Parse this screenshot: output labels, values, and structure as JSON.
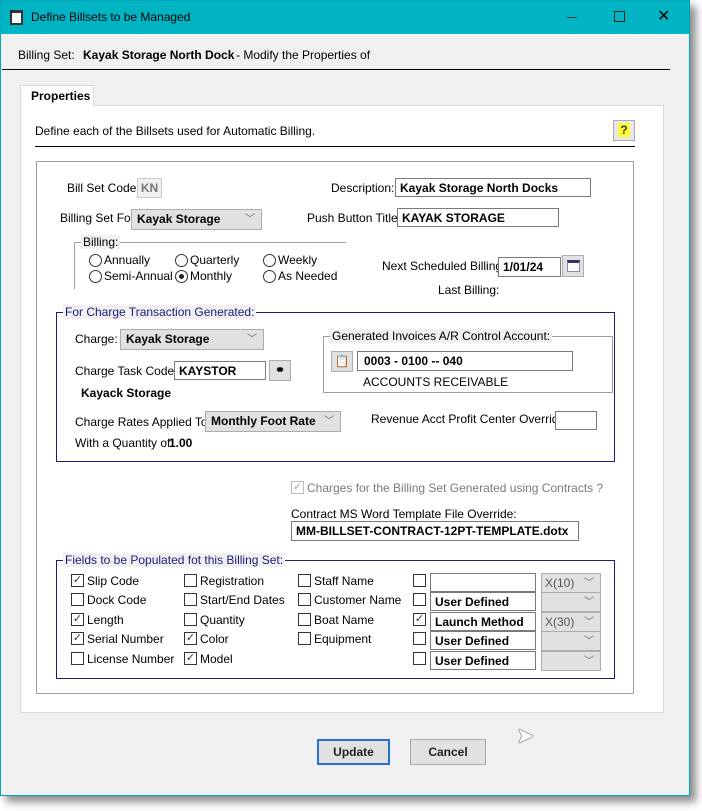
{
  "window": {
    "title": "Define Billsets to be Managed"
  },
  "header": {
    "billing_set_label": "Billing Set:",
    "billing_set_name": "Kayak Storage North Dock",
    "billing_set_suffix": "- Modify the Properties of"
  },
  "tab": {
    "label": "Properties"
  },
  "intro": "Define each of the Billsets used for Automatic Billing.",
  "form": {
    "bill_set_code_label": "Bill Set Code:",
    "bill_set_code": "KN",
    "description_label": "Description:",
    "description": "Kayak Storage North Docks",
    "billing_set_for_label": "Billing Set For:",
    "billing_set_for": "Kayak Storage",
    "push_button_title_label": "Push Button Title:",
    "push_button_title": "KAYAK STORAGE",
    "billing_label": "Billing:",
    "billing_options": [
      "Annually",
      "Quarterly",
      "Weekly",
      "Semi-Annual",
      "Monthly",
      "As Needed"
    ],
    "billing_selected": "Monthly",
    "next_billing_label": "Next Scheduled Billing:",
    "next_billing": "1/01/24",
    "last_billing_label": "Last Billing:"
  },
  "charge": {
    "group_label": "For Charge Transaction Generated:",
    "charge_label": "Charge:",
    "charge": "Kayak Storage",
    "task_code_label": "Charge Task Code:",
    "task_code": "KAYSTOR",
    "task_name": "Kayack Storage",
    "ar_group_label": "Generated Invoices A/R Control Account:",
    "ar_account": "0003 - 0100 -- 040",
    "ar_name": "ACCOUNTS RECEIVABLE",
    "rates_label": "Charge Rates Applied To:",
    "rates": "Monthly Foot Rate",
    "profit_center_label": "Revenue Acct Profit Center Override:",
    "profit_center": "",
    "quantity_label": "With a Quantity of:",
    "quantity": "1.00"
  },
  "contracts": {
    "checkbox_label": "Charges for the Billing Set Generated using Contracts ?",
    "checked": true,
    "template_label": "Contract MS Word Template File Override:",
    "template": "MM-BILLSET-CONTRACT-12PT-TEMPLATE.dotx"
  },
  "fields": {
    "group_label": "Fields to be Populated fot this Billing Set:",
    "columns": [
      [
        {
          "label": "Slip Code",
          "checked": true
        },
        {
          "label": "Dock Code",
          "checked": false
        },
        {
          "label": "Length",
          "checked": true
        },
        {
          "label": "Serial Number",
          "checked": true
        },
        {
          "label": "License Number",
          "checked": false
        }
      ],
      [
        {
          "label": "Registration",
          "checked": false
        },
        {
          "label": "Start/End Dates",
          "checked": false
        },
        {
          "label": "Quantity",
          "checked": false
        },
        {
          "label": "Color",
          "checked": true
        },
        {
          "label": "Model",
          "checked": true
        }
      ],
      [
        {
          "label": "Staff Name",
          "checked": false
        },
        {
          "label": "Customer Name",
          "checked": false
        },
        {
          "label": "Boat Name",
          "checked": false
        },
        {
          "label": "Equipment",
          "checked": false
        }
      ]
    ],
    "user_defined": [
      {
        "checked": false,
        "name": "",
        "format": "X(10)"
      },
      {
        "checked": false,
        "name": "User Defined",
        "format": ""
      },
      {
        "checked": true,
        "name": "Launch Method",
        "format": "X(30)"
      },
      {
        "checked": false,
        "name": "User Defined",
        "format": ""
      },
      {
        "checked": false,
        "name": "User Defined",
        "format": ""
      }
    ]
  },
  "buttons": {
    "update": "Update",
    "cancel": "Cancel"
  }
}
